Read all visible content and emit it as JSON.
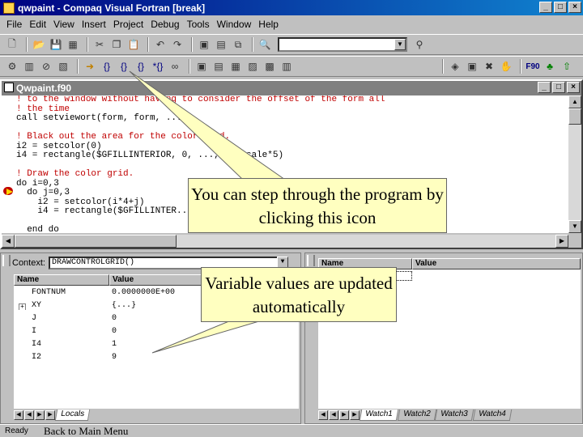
{
  "window": {
    "title": "qwpaint - Compaq Visual Fortran [break]",
    "buttons": {
      "minimize": "_",
      "maximize": "□",
      "close": "×"
    }
  },
  "menu": [
    "File",
    "Edit",
    "View",
    "Insert",
    "Project",
    "Debug",
    "Tools",
    "Window",
    "Help"
  ],
  "toolbar": {
    "row1_icons": [
      "new-file-icon",
      "open-icon",
      "save-icon",
      "save-all-icon",
      "cut-icon",
      "copy-icon",
      "paste-icon",
      "undo-icon",
      "redo-icon",
      "workspace-icon",
      "output-icon",
      "window-list-icon",
      "find-in-files-icon",
      "search-combo",
      "find-icon"
    ],
    "search_value": "",
    "row2_icons": [
      "compile-icon",
      "build-icon",
      "stop-build-icon",
      "go-icon",
      "step-into-icon",
      "step-over-icon",
      "step-out-icon",
      "run-to-cursor-icon",
      "quickwatch-icon",
      "watch-window-icon",
      "variables-window-icon",
      "registers-icon",
      "memory-icon",
      "call-stack-icon",
      "disassembly-icon",
      "class-wizard-icon",
      "stop-debug-icon",
      "fortran-icon",
      "tree-icon"
    ],
    "fortran_label": "F90"
  },
  "code_window": {
    "title": "Qwpaint.f90",
    "lines": [
      {
        "text": "! to the window without having to consider the offset of the form all",
        "comment": true
      },
      {
        "text": "! the time",
        "comment": true
      },
      {
        "text": "call setviewort(form, form, ...)",
        "comment": false
      },
      {
        "text": "",
        "comment": false
      },
      {
        "text": "! Black out the area for the color grid.",
        "comment": true
      },
      {
        "text": "i2 = setcolor(0)",
        "comment": false
      },
      {
        "text": "i4 = rectangle($GFILLINTERIOR, 0, ..., 4, scale*5)",
        "comment": false
      },
      {
        "text": "",
        "comment": false
      },
      {
        "text": "! Draw the color grid.",
        "comment": true
      },
      {
        "text": "do i=0,3",
        "comment": false
      },
      {
        "text": "  do j=0,3",
        "comment": false
      },
      {
        "text": "    i2 = setcolor(i*4+j)",
        "comment": false
      },
      {
        "text": "    i4 = rectangle($GFILLINTER...",
        "comment": false
      },
      {
        "text": "",
        "comment": false
      },
      {
        "text": "  end do",
        "comment": false
      }
    ]
  },
  "locals": {
    "context_label": "Context:",
    "context_value": "DRAWCONTROLGRID()",
    "headers": {
      "name": "Name",
      "value": "Value"
    },
    "rows": [
      {
        "name": "FONTNUM",
        "value": "0.0000000E+00",
        "expand": ""
      },
      {
        "name": "XY",
        "value": "{...}",
        "expand": "+"
      },
      {
        "name": "J",
        "value": "0",
        "expand": ""
      },
      {
        "name": "I",
        "value": "0",
        "expand": ""
      },
      {
        "name": "I4",
        "value": "1",
        "expand": ""
      },
      {
        "name": "I2",
        "value": "9",
        "expand": ""
      }
    ],
    "tabs": [
      "Locals"
    ]
  },
  "watch": {
    "headers": {
      "name": "Name",
      "value": "Value"
    },
    "tabs": [
      "Watch1",
      "Watch2",
      "Watch3",
      "Watch4"
    ]
  },
  "status": {
    "ready": "Ready",
    "back_link": "Back to Main Menu"
  },
  "callouts": {
    "step": "You can step through the program by clicking this icon",
    "variables": "Variable values are updated automatically"
  }
}
